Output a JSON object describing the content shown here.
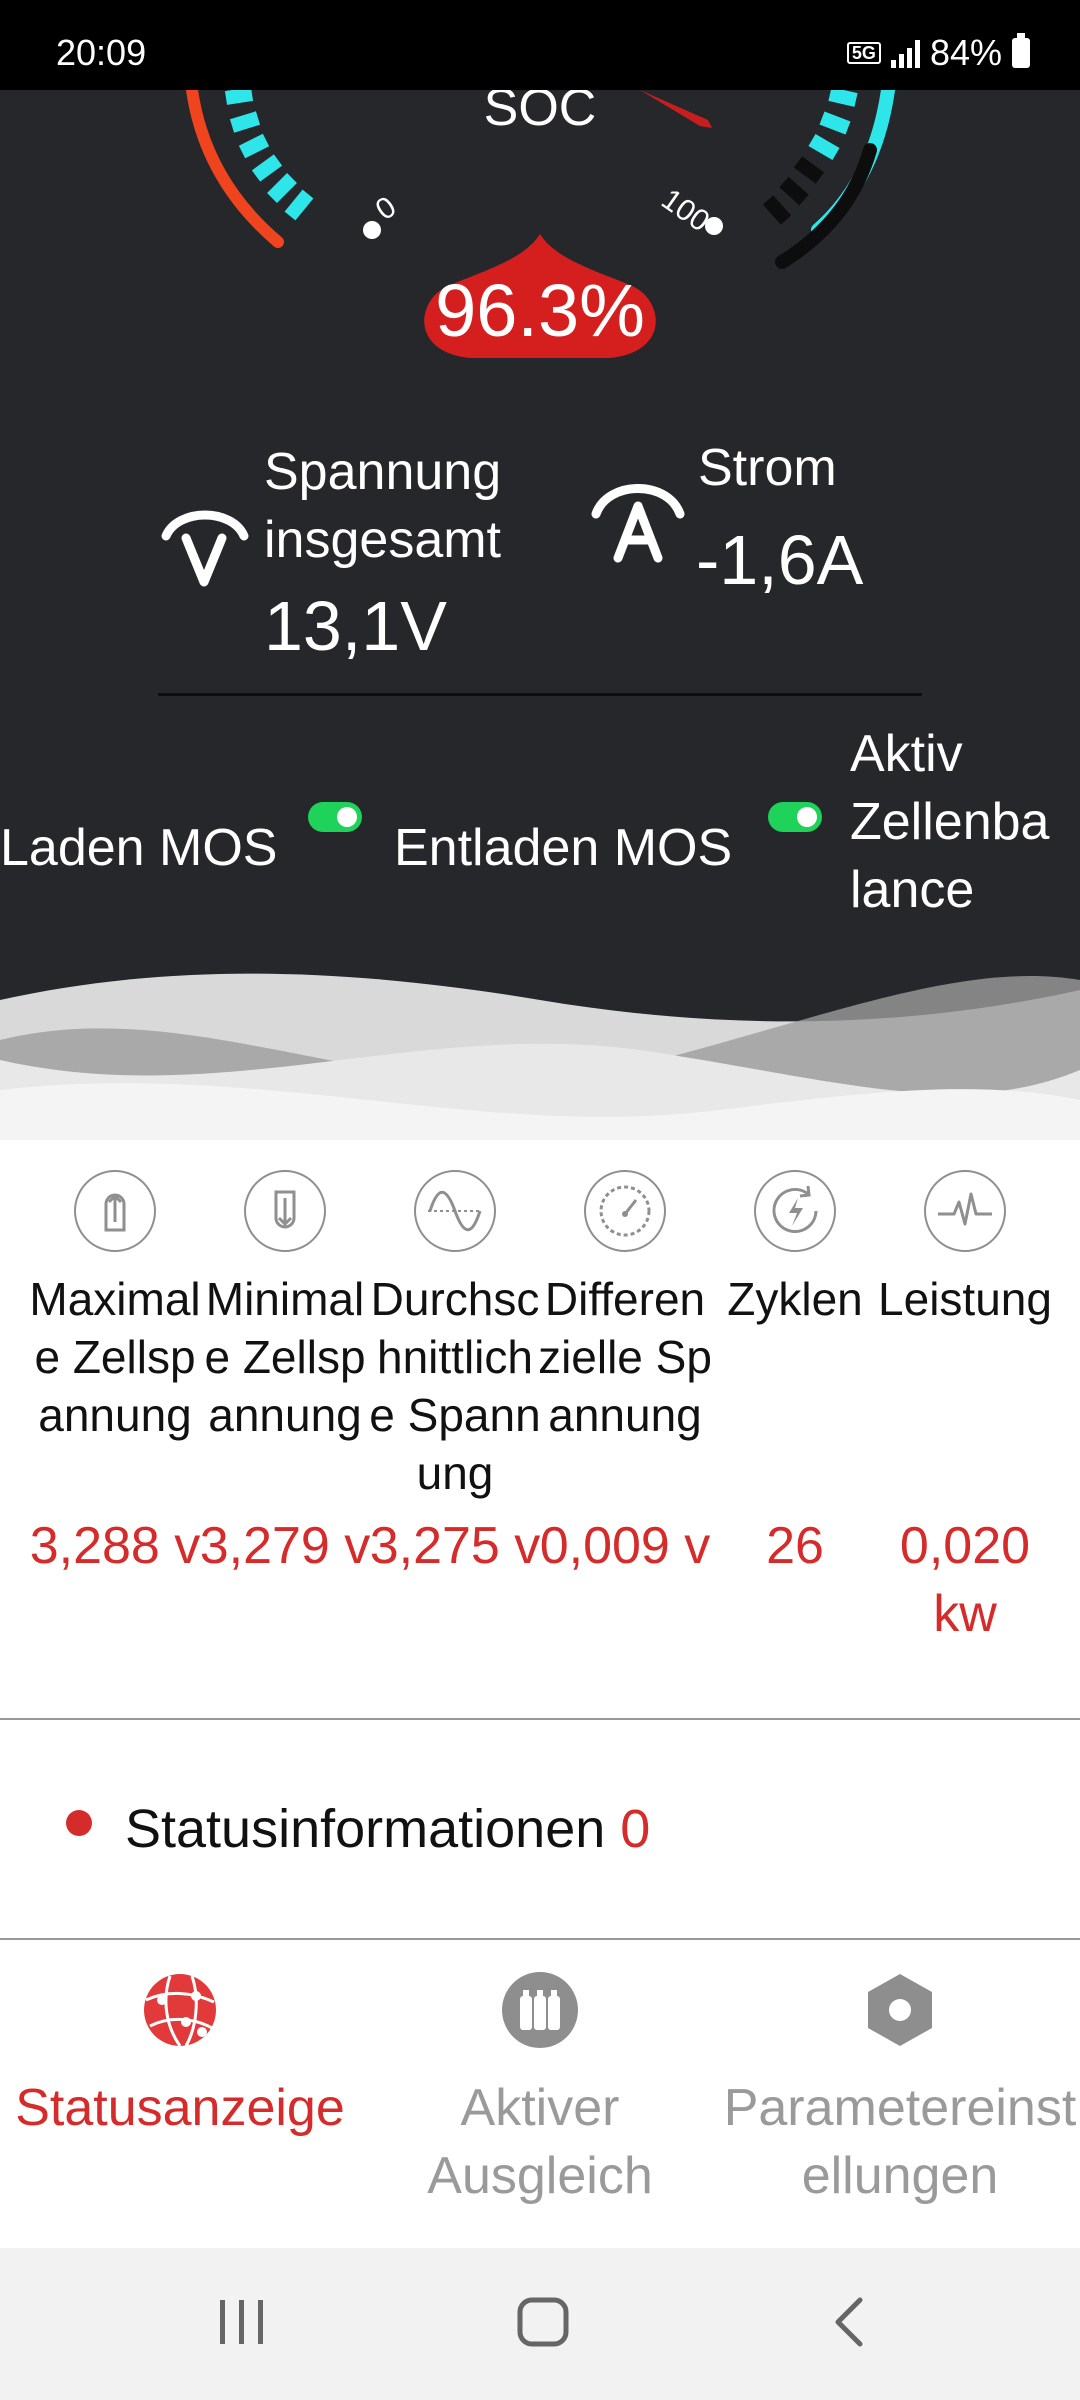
{
  "status_bar": {
    "time": "20:09",
    "network": "5G",
    "battery": "84%"
  },
  "gauge": {
    "label": "SOC",
    "value": "96.3%",
    "tick_min": "0",
    "tick_max": "100"
  },
  "voltage": {
    "label_line1": "Spannung",
    "label_line2": "insgesamt",
    "value": "13,1V"
  },
  "current": {
    "label": "Strom",
    "value": "-1,6A"
  },
  "mos": {
    "charge_label": "Laden MOS",
    "charge_on": true,
    "discharge_label": "Entladen MOS",
    "discharge_on": true,
    "balance_line1": "Aktiv",
    "balance_line2": "Zellenba",
    "balance_line3": "lance"
  },
  "metrics": [
    {
      "icon": "arrow-up-icon",
      "name": "Maximale Zellspannung",
      "value": "3,288 v"
    },
    {
      "icon": "arrow-down-icon",
      "name": "Minimale Zellspannung",
      "value": "3,279 v"
    },
    {
      "icon": "sine-wave-icon",
      "name": "Durchschnittliche Spannung",
      "value": "3,275 v"
    },
    {
      "icon": "gauge-icon",
      "name": "Differenzielle Spannung",
      "value": "0,009 v"
    },
    {
      "icon": "cycle-bolt-icon",
      "name": "Zyklen",
      "value": "26"
    },
    {
      "icon": "pulse-icon",
      "name": "Leistung",
      "value": "0,020 kw"
    }
  ],
  "status_info": {
    "label": "Statusinformationen",
    "count": "0"
  },
  "bottom_nav": {
    "items": [
      {
        "label": "Statusanzeige",
        "icon": "globe-network-icon",
        "active": true
      },
      {
        "label": "Aktiver Ausgleich",
        "icon": "battery-cells-icon",
        "active": false
      },
      {
        "label": "Parametereinstellungen",
        "icon": "hexagon-settings-icon",
        "active": false
      }
    ]
  },
  "colors": {
    "accent": "#d62b2b",
    "hero_bg": "#26272b",
    "gauge_cyan": "#2ee6ea",
    "toggle_on": "#1fd25a"
  }
}
